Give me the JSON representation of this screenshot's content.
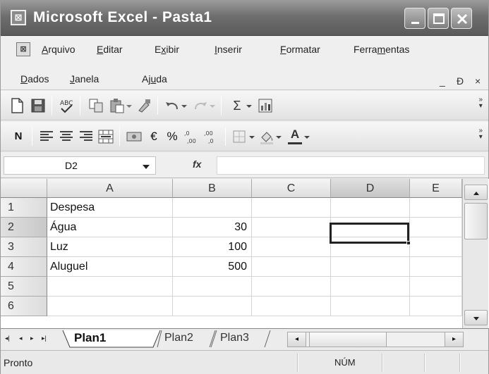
{
  "window": {
    "title": "Microsoft Excel - Pasta1"
  },
  "menu": {
    "row1": [
      {
        "pre": "",
        "ul": "A",
        "post": "rquivo"
      },
      {
        "pre": "",
        "ul": "E",
        "post": "ditar"
      },
      {
        "pre": "E",
        "ul": "x",
        "post": "ibir"
      },
      {
        "pre": "",
        "ul": "I",
        "post": "nserir"
      },
      {
        "pre": "",
        "ul": "F",
        "post": "ormatar"
      },
      {
        "pre": "Ferra",
        "ul": "m",
        "post": "entas"
      }
    ],
    "row2": [
      {
        "pre": "",
        "ul": "D",
        "post": "ados"
      },
      {
        "pre": "",
        "ul": "J",
        "post": "anela"
      },
      {
        "pre": "Aj",
        "ul": "u",
        "post": "da"
      }
    ],
    "mdi_min": "_",
    "mdi_restore": "Ð",
    "mdi_close": "×"
  },
  "toolbar": {
    "sigma": "Σ",
    "bold_label": "N",
    "euro": "€",
    "percent": "%",
    "font_color_letter": "A"
  },
  "formula_bar": {
    "name_box": "D2",
    "fx": "fx",
    "content": ""
  },
  "sheet": {
    "columns": [
      "A",
      "B",
      "C",
      "D",
      "E"
    ],
    "selected_column": "D",
    "rows": [
      {
        "n": "1",
        "a": "Despesa",
        "b": ""
      },
      {
        "n": "2",
        "a": "Água",
        "b": "30"
      },
      {
        "n": "3",
        "a": "Luz",
        "b": "100"
      },
      {
        "n": "4",
        "a": "Aluguel",
        "b": "500"
      },
      {
        "n": "5",
        "a": "",
        "b": ""
      },
      {
        "n": "6",
        "a": "",
        "b": ""
      }
    ],
    "active_cell": "D2"
  },
  "tabs": {
    "items": [
      "Plan1",
      "Plan2",
      "Plan3"
    ],
    "active": "Plan1"
  },
  "status": {
    "text": "Pronto",
    "num": "NÚM"
  }
}
